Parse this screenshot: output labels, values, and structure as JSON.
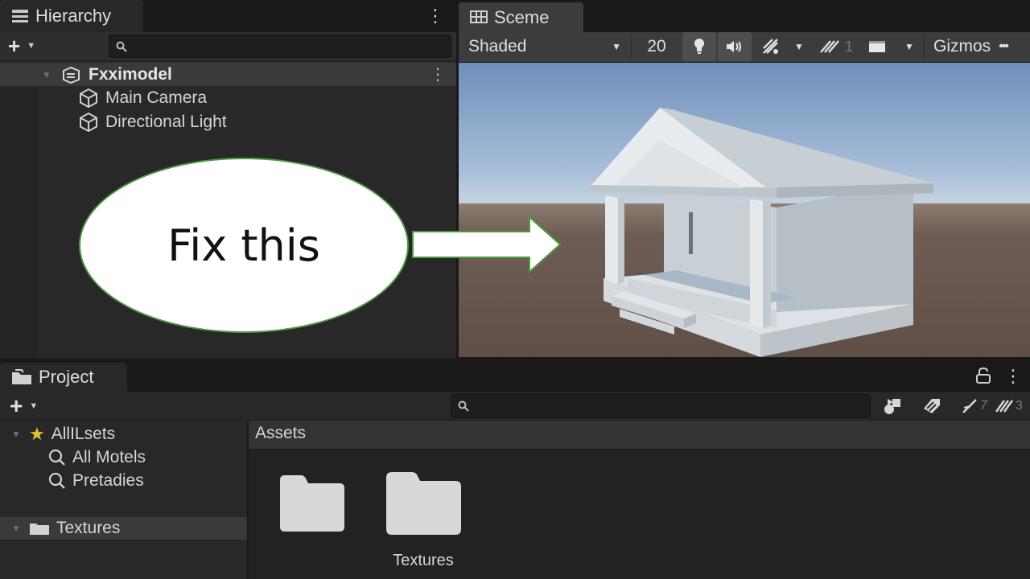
{
  "hierarchy": {
    "tab_label": "Hierarchy",
    "root_name": "Fxximodel",
    "children": [
      "Main Camera",
      "Directional Light"
    ]
  },
  "scene": {
    "tab_label": "Sceme",
    "shading_mode": "Shaded",
    "toggle_2d": "20",
    "fx_count": "1",
    "gizmos_label": "Gizmos"
  },
  "annotation": {
    "callout_text": "Fix this",
    "color": "#4a9a3e"
  },
  "project": {
    "tab_label": "Project",
    "favorites": {
      "label": "AllILsets",
      "items": [
        "All Motels",
        "Pretadies"
      ]
    },
    "tree_folder": "Textures",
    "breadcrumb": "Assets",
    "hidden_count": "7",
    "layer_count": "3",
    "assets": [
      {
        "icon": "folder-icon",
        "name": ""
      },
      {
        "icon": "folder-icon",
        "name": "Textures"
      }
    ]
  },
  "colors": {
    "panel": "#282828",
    "toolbar": "#3c3c3c",
    "selection": "#3a3a3a",
    "sky_top": "#6f8fbb",
    "ground": "#6b5b52"
  }
}
